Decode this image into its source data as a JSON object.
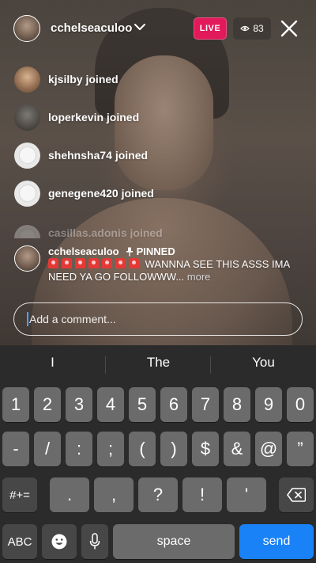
{
  "header": {
    "username": "cchelseaculoo",
    "live_label": "LIVE",
    "viewer_count": "83"
  },
  "feed": [
    {
      "user": "kjsilby",
      "action": "joined"
    },
    {
      "user": "loperkevin",
      "action": "joined"
    },
    {
      "user": "shehnsha74",
      "action": "joined"
    },
    {
      "user": "genegene420",
      "action": "joined"
    },
    {
      "user": "casillas.adonis",
      "action": "joined"
    }
  ],
  "pinned": {
    "username": "cchelseaculoo",
    "label": "PINNED",
    "message": "WANNNA SEE THIS ASSS IMA NEED YA GO FOLLOWWW...",
    "more_label": "more"
  },
  "comment": {
    "placeholder": "Add a comment..."
  },
  "keyboard": {
    "suggestions": [
      "I",
      "The",
      "You"
    ],
    "row1": [
      "1",
      "2",
      "3",
      "4",
      "5",
      "6",
      "7",
      "8",
      "9",
      "0"
    ],
    "row2": [
      "-",
      "/",
      ":",
      ";",
      "(",
      ")",
      "$",
      "&",
      "@",
      "”"
    ],
    "row3_left": "#+=",
    "row3": [
      ".",
      ",",
      "?",
      "!",
      "'"
    ],
    "abc_label": "ABC",
    "space_label": "space",
    "send_label": "send"
  },
  "colors": {
    "live": "#e2195b",
    "send": "#1a82f7",
    "keyboard_bg": "#2b2b2b"
  }
}
